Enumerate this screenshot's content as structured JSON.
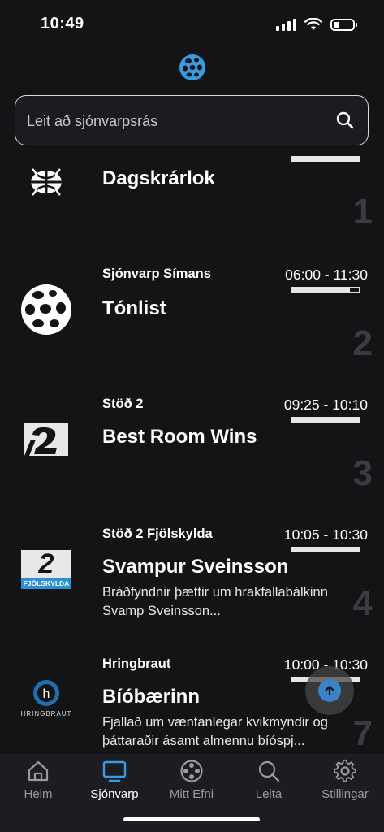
{
  "status_bar": {
    "time": "10:49",
    "battery_level": 0.3
  },
  "search": {
    "placeholder": "Leit að sjónvarpsrás"
  },
  "channels": [
    {
      "name": "",
      "time": "",
      "title": "Dagskrárlok",
      "description": "",
      "number": "1",
      "progress": 1.0
    },
    {
      "name": "Sjónvarp Símans",
      "time": "06:00 - 11:30",
      "title": "Tónlist",
      "description": "",
      "number": "2",
      "progress": 0.87
    },
    {
      "name": "Stöð 2",
      "time": "09:25 - 10:10",
      "title": "Best Room Wins",
      "description": "",
      "number": "3",
      "progress": 1.0
    },
    {
      "name": "Stöð 2 Fjölskylda",
      "time": "10:05 - 10:30",
      "title": "Svampur Sveinsson",
      "description": "Bráðfyndnir þættir um hrakfallabálkinn Svamp Sveinsson...",
      "number": "4",
      "progress": 1.0
    },
    {
      "name": "Hringbraut",
      "time": "10:00 - 10:30",
      "title": "Bíóbærinn",
      "description": "Fjallað um væntanlegar kvikmyndir og þáttaraðir ásamt almennu bíóspj...",
      "number": "7",
      "progress": 1.0,
      "logo_text": "HRINGBRAUT"
    }
  ],
  "logos": {
    "stod2_family_text": "FJÖLSKYLDA",
    "stod2_digit": "2"
  },
  "tabs": [
    {
      "label": "Heim",
      "icon": "home-icon",
      "active": false
    },
    {
      "label": "Sjónvarp",
      "icon": "tv-icon",
      "active": true
    },
    {
      "label": "Mitt Efni",
      "icon": "film-reel-icon",
      "active": false
    },
    {
      "label": "Leita",
      "icon": "search-icon",
      "active": false
    },
    {
      "label": "Stillingar",
      "icon": "gear-icon",
      "active": false
    }
  ],
  "colors": {
    "accent": "#3b9ae0",
    "divider": "#2b4a63",
    "background": "#121416"
  }
}
